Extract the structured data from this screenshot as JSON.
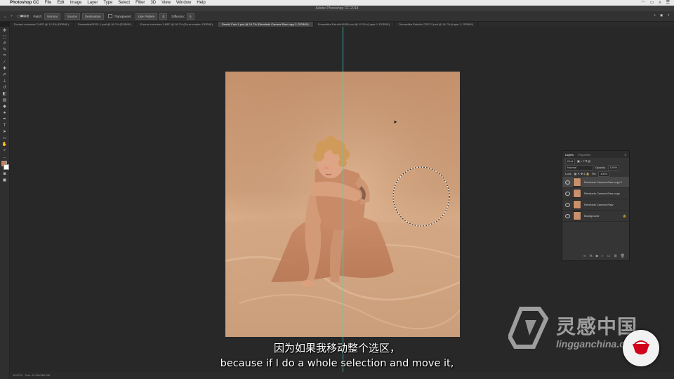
{
  "macos_menubar": {
    "app": "Photoshop CC",
    "menus": [
      "File",
      "Edit",
      "Image",
      "Layer",
      "Type",
      "Select",
      "Filter",
      "3D",
      "View",
      "Window",
      "Help"
    ]
  },
  "window_title": "Adobe Photoshop CC 2018",
  "options_bar": {
    "patch_label": "Patch:",
    "patch_value": "Normal",
    "source": "Source",
    "destination": "Destination",
    "transparent": "Transparent",
    "use_pattern": "Use Pattern",
    "diffusion_label": "Diffusion:",
    "diffusion_value": "5"
  },
  "tabs": [
    "Errores comunes 2.NEF @ 12.5% (RGB/8*)",
    "Domestika13291 1.psd @ 16.7% (RGB/8*)",
    "Errores comunes 1.NEF @ 16.7% (Re-encuadre, RGB/8*)",
    "Desnik Foto 1.psd @ 16.7% (Revelado Camera Raw copy 2, RGB/8*)",
    "Domestika Estudio16390.psd @ 12.5% (Layer 1, RGB/8*)",
    "Domestika Estudio17287-2.psd @ 16.7% (Layer 1, RGB/8*)"
  ],
  "active_tab_index": 3,
  "status_bar": {
    "zoom": "16.67%",
    "doc": "Doc: 91.2M/360.9M"
  },
  "layers_panel": {
    "tab_layers": "Layers",
    "tab_properties": "Properties",
    "filter": "Kind",
    "blend_mode": "Normal",
    "opacity_label": "Opacity:",
    "opacity_value": "100%",
    "lock_label": "Lock:",
    "fill_label": "Fill:",
    "fill_value": "100%",
    "layers": [
      {
        "name": "Revelado Camera Raw copy 2",
        "active": true
      },
      {
        "name": "Revelado Camera Raw copy",
        "active": false
      },
      {
        "name": "Revelado Camera Raw",
        "active": false
      },
      {
        "name": "Background",
        "active": false
      }
    ]
  },
  "subtitles": {
    "cn": "因为如果我移动整个选区，",
    "en": "because if I do a whole selection and move it,"
  },
  "watermark": {
    "brand": "灵感中国",
    "url": "lingganchina.com"
  },
  "colors": {
    "backdrop": "#c79a74",
    "skin": "#d59a76",
    "foreground_swatch": "#c97f5c"
  }
}
